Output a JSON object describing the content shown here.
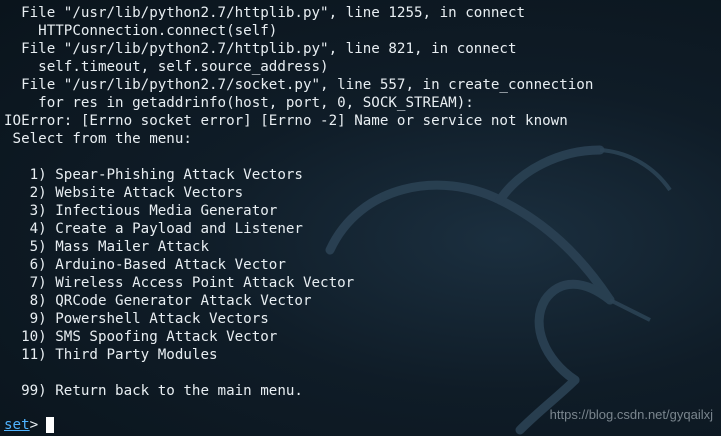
{
  "terminal": {
    "lines": [
      "  File \"/usr/lib/python2.7/httplib.py\", line 1255, in connect",
      "    HTTPConnection.connect(self)",
      "  File \"/usr/lib/python2.7/httplib.py\", line 821, in connect",
      "    self.timeout, self.source_address)",
      "  File \"/usr/lib/python2.7/socket.py\", line 557, in create_connection",
      "    for res in getaddrinfo(host, port, 0, SOCK_STREAM):",
      "IOError: [Errno socket error] [Errno -2] Name or service not known",
      " Select from the menu:",
      "",
      "   1) Spear-Phishing Attack Vectors",
      "   2) Website Attack Vectors",
      "   3) Infectious Media Generator",
      "   4) Create a Payload and Listener",
      "   5) Mass Mailer Attack",
      "   6) Arduino-Based Attack Vector",
      "   7) Wireless Access Point Attack Vector",
      "   8) QRCode Generator Attack Vector",
      "   9) Powershell Attack Vectors",
      "  10) SMS Spoofing Attack Vector",
      "  11) Third Party Modules",
      "",
      "  99) Return back to the main menu."
    ],
    "prompt_word": "set",
    "prompt_symbol": ">",
    "watermark": "https://blog.csdn.net/gyqailxj"
  }
}
